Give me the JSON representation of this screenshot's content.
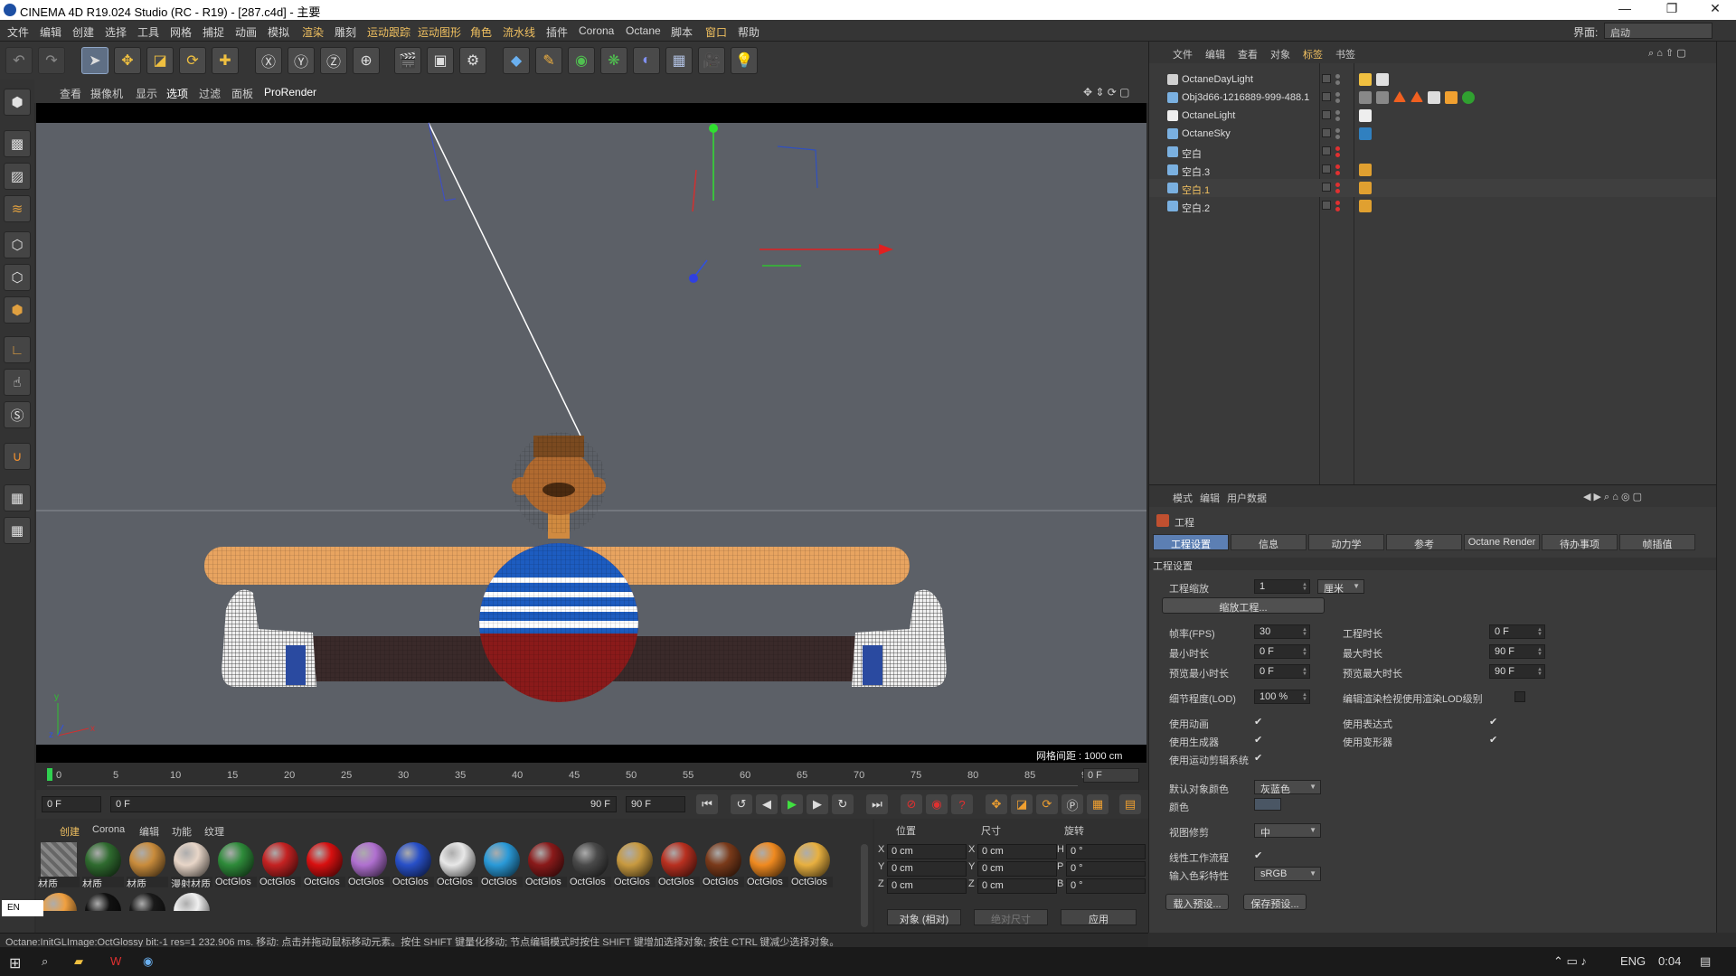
{
  "window": {
    "title": "CINEMA 4D R19.024 Studio (RC - R19) - [287.c4d] - 主要",
    "minimize": "—",
    "restore": "❐",
    "close": "✕"
  },
  "menu": [
    "文件",
    "编辑",
    "创建",
    "选择",
    "工具",
    "网格",
    "捕捉",
    "动画",
    "模拟",
    "渲染",
    "雕刻",
    "运动跟踪",
    "运动图形",
    "角色",
    "流水线",
    "插件",
    "Corona",
    "Octane",
    "脚本",
    "窗口",
    "帮助"
  ],
  "layout": {
    "label": "界面:",
    "value": "启动"
  },
  "toolbar_icons": [
    "undo-icon",
    "redo-icon",
    "select-arrow-icon",
    "move-icon",
    "scale-icon",
    "rotate-icon",
    "transform-icon",
    "x-axis-icon",
    "y-axis-icon",
    "z-axis-icon",
    "world-coord-icon",
    "render-view-icon",
    "render-picture-icon",
    "render-settings-icon",
    "cube-icon",
    "pen-icon",
    "subdivision-icon",
    "cloner-icon",
    "deformer-icon",
    "floor-icon",
    "camera-icon",
    "light-icon"
  ],
  "viewport_menu": [
    "查看",
    "摄像机",
    "显示",
    "选项",
    "过滤",
    "面板",
    "ProRender"
  ],
  "grid_spacing": "网格间距 : 1000 cm",
  "timeline": {
    "ticks": [
      "0",
      "5",
      "10",
      "15",
      "20",
      "25",
      "30",
      "35",
      "40",
      "45",
      "50",
      "55",
      "60",
      "65",
      "70",
      "75",
      "80",
      "85",
      "90"
    ],
    "current": "0 F",
    "start": "0 F",
    "range_start": "0 F",
    "range_end": "90 F",
    "end": "90 F"
  },
  "material_tabs": [
    "创建",
    "Corona",
    "编辑",
    "功能",
    "纹理"
  ],
  "materials": [
    {
      "label": "材质",
      "color": "#777777"
    },
    {
      "label": "材质",
      "color": "#2f6b2f"
    },
    {
      "label": "材质",
      "color": "#c98c3c"
    },
    {
      "label": "漫射材质",
      "color": "#e8d6c8"
    },
    {
      "label": "OctGlos",
      "color": "#2e8b3a"
    },
    {
      "label": "OctGlos",
      "color": "#c42222"
    },
    {
      "label": "OctGlos",
      "color": "#d81010"
    },
    {
      "label": "OctGlos",
      "color": "#b070d0"
    },
    {
      "label": "OctGlos",
      "color": "#2850c8"
    },
    {
      "label": "OctGlos",
      "color": "#e8e8e8"
    },
    {
      "label": "OctGlos",
      "color": "#2a9ad8"
    },
    {
      "label": "OctGlos",
      "color": "#8a1a1a"
    },
    {
      "label": "OctGlos",
      "color": "#4a4a4a"
    },
    {
      "label": "OctGlos",
      "color": "#c89a40"
    },
    {
      "label": "OctGlos",
      "color": "#b83020"
    },
    {
      "label": "OctGlos",
      "color": "#7a3a1a"
    },
    {
      "label": "OctGlos",
      "color": "#f08a20"
    },
    {
      "label": "OctGlos",
      "color": "#e8b040"
    }
  ],
  "materials_row2": [
    "#f0a040",
    "#111111",
    "#1a1a1a",
    "#f0f0f0"
  ],
  "coords": {
    "headers": [
      "位置",
      "尺寸",
      "旋转"
    ],
    "rows": [
      {
        "ax": "X",
        "pos": "0 cm",
        "size": "0 cm",
        "rax": "H",
        "rot": "0 °"
      },
      {
        "ax": "Y",
        "pos": "0 cm",
        "size": "0 cm",
        "rax": "P",
        "rot": "0 °"
      },
      {
        "ax": "Z",
        "pos": "0 cm",
        "size": "0 cm",
        "rax": "B",
        "rot": "0 °"
      }
    ],
    "mode": "对象 (相对)",
    "size_mode": "绝对尺寸",
    "apply": "应用"
  },
  "status": "Octane:InitGLImage:OctGlossy  bit:-1 res=1  232.906 ms.   移动: 点击并拖动鼠标移动元素。按住 SHIFT 键量化移动; 节点编辑模式时按住 SHIFT 键增加选择对象; 按住 CTRL 键减少选择对象。",
  "language": "EN",
  "object_manager": {
    "menu": [
      "文件",
      "编辑",
      "查看",
      "对象",
      "标签",
      "书签"
    ],
    "objects": [
      {
        "name": "OctaneDayLight",
        "selected": false,
        "icon": "#d0d0d0"
      },
      {
        "name": "Obj3d66-1216889-999-488.1",
        "selected": false,
        "icon": "#7ab0e0"
      },
      {
        "name": "OctaneLight",
        "selected": false,
        "icon": "#eeeeee"
      },
      {
        "name": "OctaneSky",
        "selected": false,
        "icon": "#7ab0e0"
      },
      {
        "name": "空白",
        "selected": false,
        "icon": "#7ab0e0"
      },
      {
        "name": "空白.3",
        "selected": false,
        "icon": "#7ab0e0"
      },
      {
        "name": "空白.1",
        "selected": true,
        "icon": "#7ab0e0"
      },
      {
        "name": "空白.2",
        "selected": false,
        "icon": "#7ab0e0"
      }
    ]
  },
  "attributes": {
    "menu": [
      "模式",
      "编辑",
      "用户数据"
    ],
    "title": "工程",
    "tabs": [
      "工程设置",
      "信息",
      "动力学",
      "参考",
      "Octane Render",
      "待办事项",
      "帧插值"
    ],
    "section": "工程设置",
    "scale_label": "工程缩放",
    "scale_value": "1",
    "scale_unit": "厘米",
    "scale_button": "缩放工程...",
    "fps_label": "帧率(FPS)",
    "fps": "30",
    "min_label": "最小时长",
    "min": "0 F",
    "pmin_label": "预览最小时长",
    "pmin": "0 F",
    "dur_label": "工程时长",
    "dur": "0 F",
    "max_label": "最大时长",
    "max": "90 F",
    "pmax_label": "预览最大时长",
    "pmax": "90 F",
    "lod_label": "细节程度(LOD)",
    "lod": "100 %",
    "lod_render_label": "编辑渲染检视使用渲染LOD级别",
    "anim_label": "使用动画",
    "gen_label": "使用生成器",
    "mg_label": "使用运动剪辑系统",
    "expr_label": "使用表达式",
    "deform_label": "使用变形器",
    "defcolor_label": "默认对象颜色",
    "defcolor": "灰蓝色",
    "color_label": "颜色",
    "view_clip_label": "视图修剪",
    "view_clip": "中",
    "linear_label": "线性工作流程",
    "input_color_label": "输入色彩特性",
    "input_color": "sRGB",
    "load_preset": "载入预设...",
    "save_preset": "保存预设..."
  },
  "taskbar": {
    "lang": "ENG",
    "time": "0:04"
  }
}
